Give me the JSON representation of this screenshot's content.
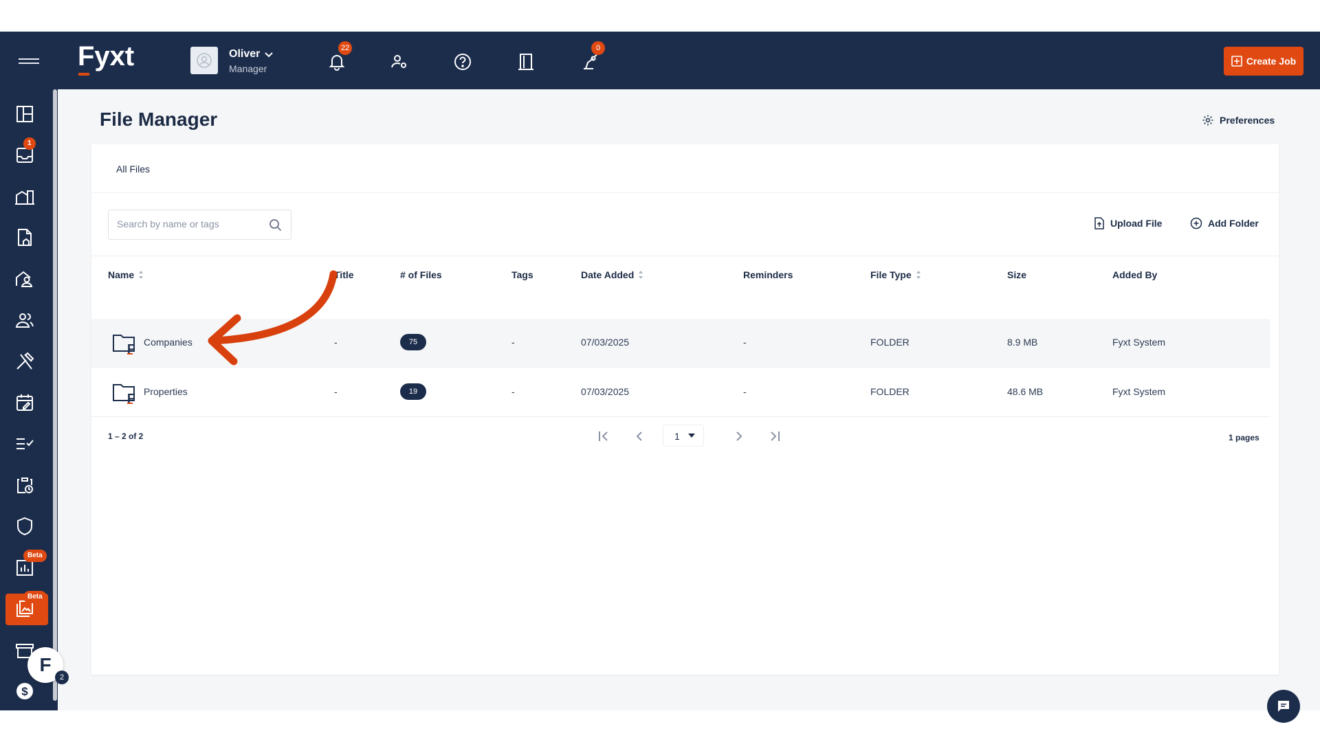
{
  "app": {
    "brand": "Fyxt",
    "accent": "#e04a12",
    "nav_bg": "#1c2d4c"
  },
  "user": {
    "name": "Oliver",
    "role": "Manager"
  },
  "header": {
    "notifications_count": "22",
    "alerts_count": "0",
    "create_job_label": "Create Job",
    "icons": [
      "bell-icon",
      "user-settings-icon",
      "help-icon",
      "door-icon",
      "robot-icon"
    ]
  },
  "sidebar": {
    "inbox_badge": "1",
    "reports_badge": "Beta",
    "files_badge": "Beta",
    "fab_letter": "F",
    "fab_badge": "2",
    "icons": [
      "dashboard-icon",
      "inbox-icon",
      "properties-icon",
      "leases-icon",
      "tenants-icon",
      "contacts-icon",
      "jobs-icon",
      "calendar-icon",
      "tasks-icon",
      "schedule-icon",
      "shield-icon",
      "reports-icon",
      "files-icon",
      "vendors-icon",
      "billing-icon"
    ]
  },
  "page": {
    "title": "File Manager",
    "preferences_label": "Preferences"
  },
  "breadcrumb": "All Files",
  "toolbar": {
    "search_placeholder": "Search by name or tags",
    "upload_label": "Upload File",
    "add_folder_label": "Add Folder"
  },
  "table": {
    "columns": [
      "Name",
      "Title",
      "# of Files",
      "Tags",
      "Date Added",
      "Reminders",
      "File Type",
      "Size",
      "Added By"
    ],
    "rows": [
      {
        "name": "Companies",
        "title": "-",
        "files": "75",
        "tags": "-",
        "date": "07/03/2025",
        "reminders": "-",
        "type": "FOLDER",
        "size": "8.9 MB",
        "added_by": "Fyxt System"
      },
      {
        "name": "Properties",
        "title": "-",
        "files": "19",
        "tags": "-",
        "date": "07/03/2025",
        "reminders": "-",
        "type": "FOLDER",
        "size": "48.6 MB",
        "added_by": "Fyxt System"
      }
    ]
  },
  "pagination": {
    "range": "1 – 2 of 2",
    "current_page": "1",
    "total": "1 pages"
  }
}
